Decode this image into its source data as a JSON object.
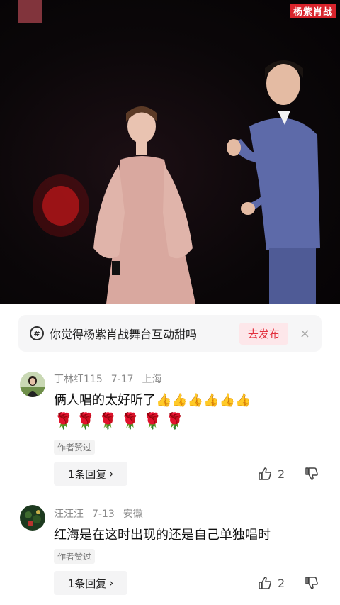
{
  "video": {
    "watermark": "杨紫肖战"
  },
  "prompt": {
    "icon": "hash-icon",
    "text": "你觉得杨紫肖战舞台互动甜吗",
    "action_label": "去发布",
    "close": "×"
  },
  "comments": [
    {
      "username": "丁林红115",
      "date": "7-17",
      "location": "上海",
      "text": "俩人唱的太好听了👍👍👍👍👍👍",
      "emojis": [
        "🌹",
        "🌹",
        "🌹",
        "🌹",
        "🌹",
        "🌹"
      ],
      "tag": "作者赞过",
      "reply_label": "1条回复",
      "reply_chevron": "›",
      "likes": "2"
    },
    {
      "username": "汪汪汪",
      "date": "7-13",
      "location": "安徽",
      "text": "红海是在这时出现的还是自己单独唱时",
      "tag": "作者赞过",
      "reply_label": "1条回复",
      "reply_chevron": "›",
      "likes": "2"
    }
  ]
}
